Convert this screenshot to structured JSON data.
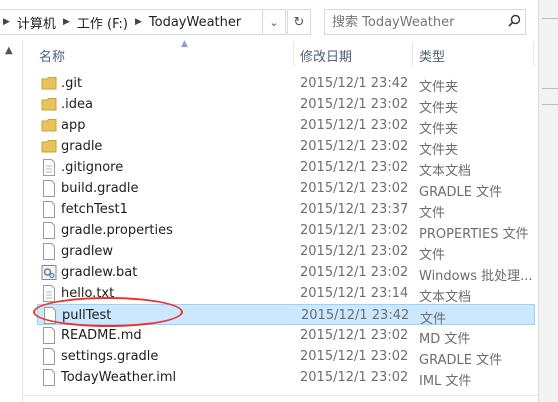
{
  "address": {
    "crumbs": [
      "计算机",
      "工作 (F:)",
      "TodayWeather"
    ],
    "dropdown_icon": "chevron-down-icon",
    "refresh_icon": "refresh-icon"
  },
  "search": {
    "placeholder": "搜索 TodayWeather",
    "icon": "search-icon"
  },
  "columns": {
    "name": "名称",
    "date": "修改日期",
    "type": "类型"
  },
  "files": [
    {
      "name": ".git",
      "date": "2015/12/1 23:42",
      "type": "文件夹",
      "icon": "folder-icon"
    },
    {
      "name": ".idea",
      "date": "2015/12/1 23:02",
      "type": "文件夹",
      "icon": "folder-icon"
    },
    {
      "name": "app",
      "date": "2015/12/1 23:02",
      "type": "文件夹",
      "icon": "folder-icon"
    },
    {
      "name": "gradle",
      "date": "2015/12/1 23:02",
      "type": "文件夹",
      "icon": "folder-icon"
    },
    {
      "name": ".gitignore",
      "date": "2015/12/1 23:02",
      "type": "文本文档",
      "icon": "text-file-icon"
    },
    {
      "name": "build.gradle",
      "date": "2015/12/1 23:02",
      "type": "GRADLE 文件",
      "icon": "file-icon"
    },
    {
      "name": "fetchTest1",
      "date": "2015/12/1 23:37",
      "type": "文件",
      "icon": "file-icon"
    },
    {
      "name": "gradle.properties",
      "date": "2015/12/1 23:02",
      "type": "PROPERTIES 文件",
      "icon": "file-icon"
    },
    {
      "name": "gradlew",
      "date": "2015/12/1 23:02",
      "type": "文件",
      "icon": "file-icon"
    },
    {
      "name": "gradlew.bat",
      "date": "2015/12/1 23:02",
      "type": "Windows 批处理...",
      "icon": "batch-file-icon"
    },
    {
      "name": "hello.txt",
      "date": "2015/12/1 23:14",
      "type": "文本文档",
      "icon": "text-file-icon"
    },
    {
      "name": "pullTest",
      "date": "2015/12/1 23:42",
      "type": "文件",
      "icon": "file-icon",
      "selected": true
    },
    {
      "name": "README.md",
      "date": "2015/12/1 23:02",
      "type": "MD 文件",
      "icon": "file-icon"
    },
    {
      "name": "settings.gradle",
      "date": "2015/12/1 23:02",
      "type": "GRADLE 文件",
      "icon": "file-icon"
    },
    {
      "name": "TodayWeather.iml",
      "date": "2015/12/1 23:02",
      "type": "IML 文件",
      "icon": "file-icon"
    }
  ]
}
